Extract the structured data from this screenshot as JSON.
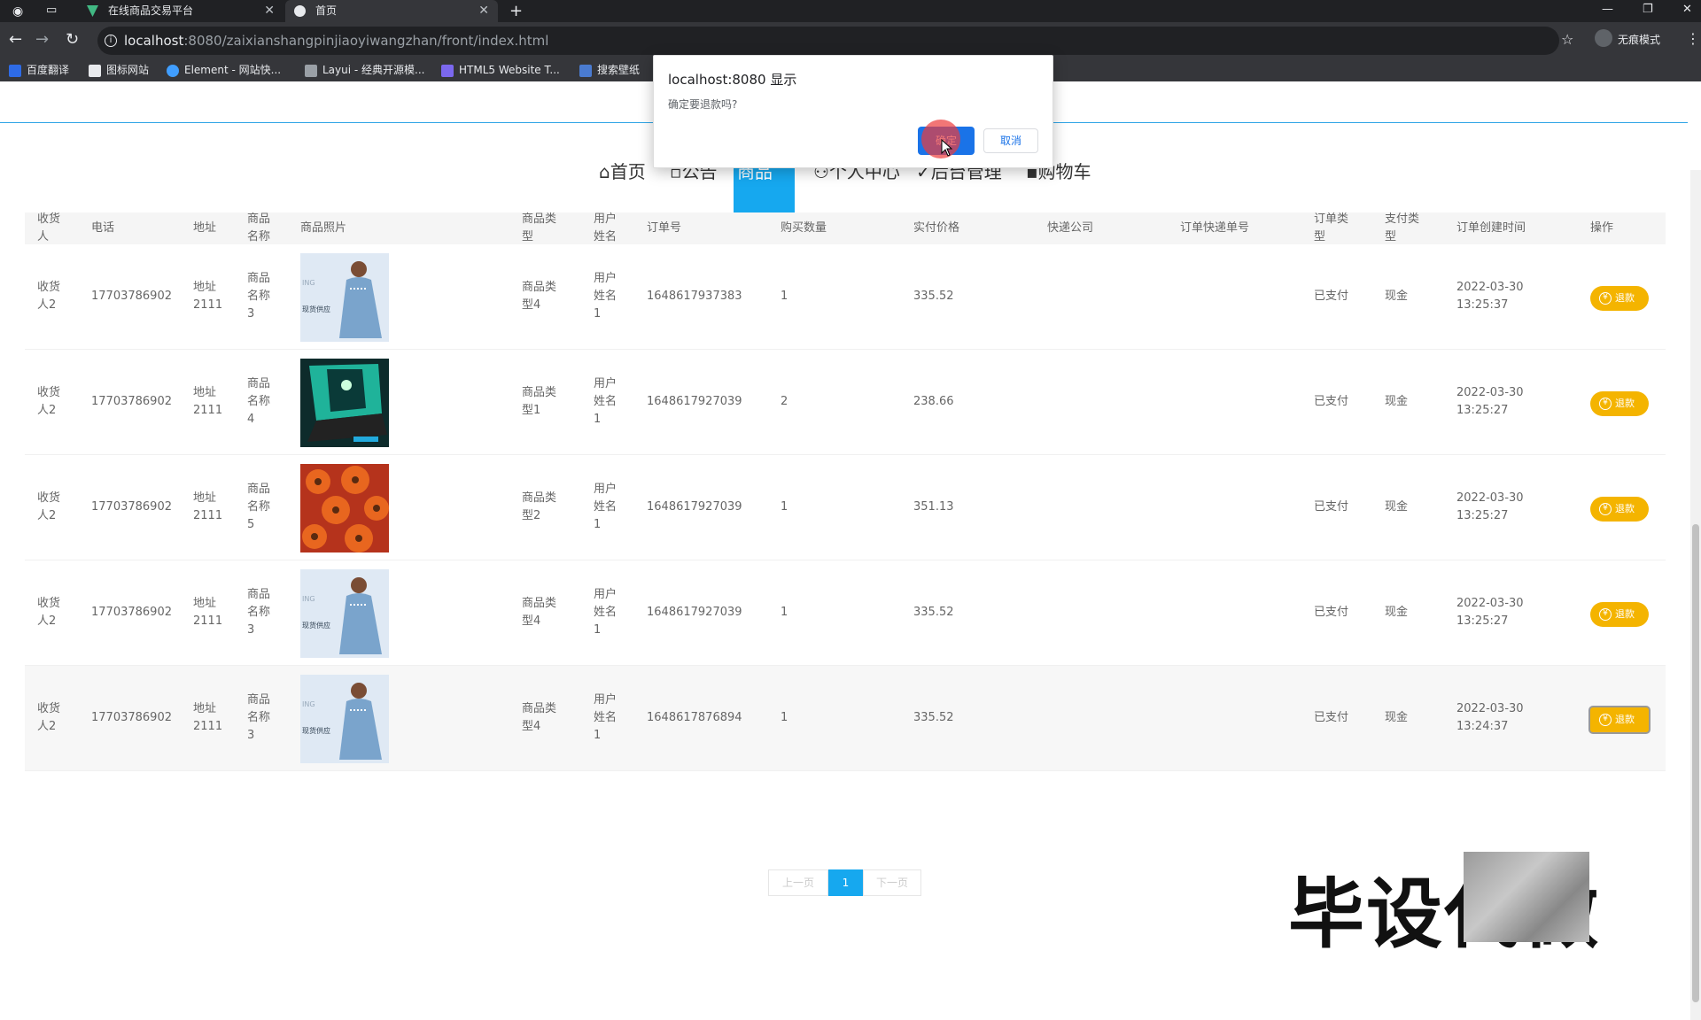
{
  "browser": {
    "tabs": [
      {
        "label": "在线商品交易平台"
      },
      {
        "label": "首页"
      }
    ],
    "new_tab": "+",
    "url_host": "localhost",
    "url_path": ":8080/zaixianshangpinjiaoyiwangzhan/front/index.html",
    "incognito_label": "无痕模式",
    "bookmarks": [
      {
        "label": "百度翻译",
        "color": "#2e6be6"
      },
      {
        "label": "图标网站",
        "color": "#e8eaed"
      },
      {
        "label": "Element - 网站快...",
        "color": "#409eff"
      },
      {
        "label": "Layui - 经典开源模...",
        "color": "#9aa0a6"
      },
      {
        "label": "HTML5 Website T...",
        "color": "#7b68ee"
      },
      {
        "label": "搜索壁纸",
        "color": "#4a7bd0"
      }
    ]
  },
  "nav": {
    "items": [
      "首页",
      "公告",
      "商品",
      "个人中心",
      "后台管理",
      "购物车"
    ]
  },
  "table": {
    "headers": [
      "收货人",
      "电话",
      "地址",
      "商品名称",
      "商品照片",
      "商品类型",
      "用户姓名",
      "订单号",
      "购买数量",
      "实付价格",
      "快递公司",
      "订单快递单号",
      "订单类型",
      "支付类型",
      "订单创建时间",
      "操作"
    ],
    "rows": [
      {
        "receiver": "收货人2",
        "phone": "17703786902",
        "address": "地址2111",
        "name": "商品名称3",
        "type": "商品类型4",
        "user": "用户姓名1",
        "order_no": "1648617937383",
        "qty": "1",
        "price": "335.52",
        "status": "已支付",
        "pay": "现金",
        "date": "2022-03-30",
        "time": "13:25:37",
        "photo": "dress"
      },
      {
        "receiver": "收货人2",
        "phone": "17703786902",
        "address": "地址2111",
        "name": "商品名称4",
        "type": "商品类型1",
        "user": "用户姓名1",
        "order_no": "1648617927039",
        "qty": "2",
        "price": "238.66",
        "status": "已支付",
        "pay": "现金",
        "date": "2022-03-30",
        "time": "13:25:27",
        "photo": "laptop"
      },
      {
        "receiver": "收货人2",
        "phone": "17703786902",
        "address": "地址2111",
        "name": "商品名称5",
        "type": "商品类型2",
        "user": "用户姓名1",
        "order_no": "1648617927039",
        "qty": "1",
        "price": "351.13",
        "status": "已支付",
        "pay": "现金",
        "date": "2022-03-30",
        "time": "13:25:27",
        "photo": "flowers"
      },
      {
        "receiver": "收货人2",
        "phone": "17703786902",
        "address": "地址2111",
        "name": "商品名称3",
        "type": "商品类型4",
        "user": "用户姓名1",
        "order_no": "1648617927039",
        "qty": "1",
        "price": "335.52",
        "status": "已支付",
        "pay": "现金",
        "date": "2022-03-30",
        "time": "13:25:27",
        "photo": "dress"
      },
      {
        "receiver": "收货人2",
        "phone": "17703786902",
        "address": "地址2111",
        "name": "商品名称3",
        "type": "商品类型4",
        "user": "用户姓名1",
        "order_no": "1648617876894",
        "qty": "1",
        "price": "335.52",
        "status": "已支付",
        "pay": "现金",
        "date": "2022-03-30",
        "time": "13:24:37",
        "photo": "dress"
      }
    ],
    "refund_label": "退款"
  },
  "pagination": {
    "prev": "上一页",
    "current": "1",
    "next": "下一页"
  },
  "watermark": "毕设代做",
  "dialog": {
    "title": "localhost:8080 显示",
    "message": "确定要退款吗?",
    "ok": "确定",
    "cancel": "取消"
  },
  "colors": {
    "accent": "#16a8ef",
    "refund": "#f4b400",
    "dialog_ok": "#1a73e8"
  }
}
